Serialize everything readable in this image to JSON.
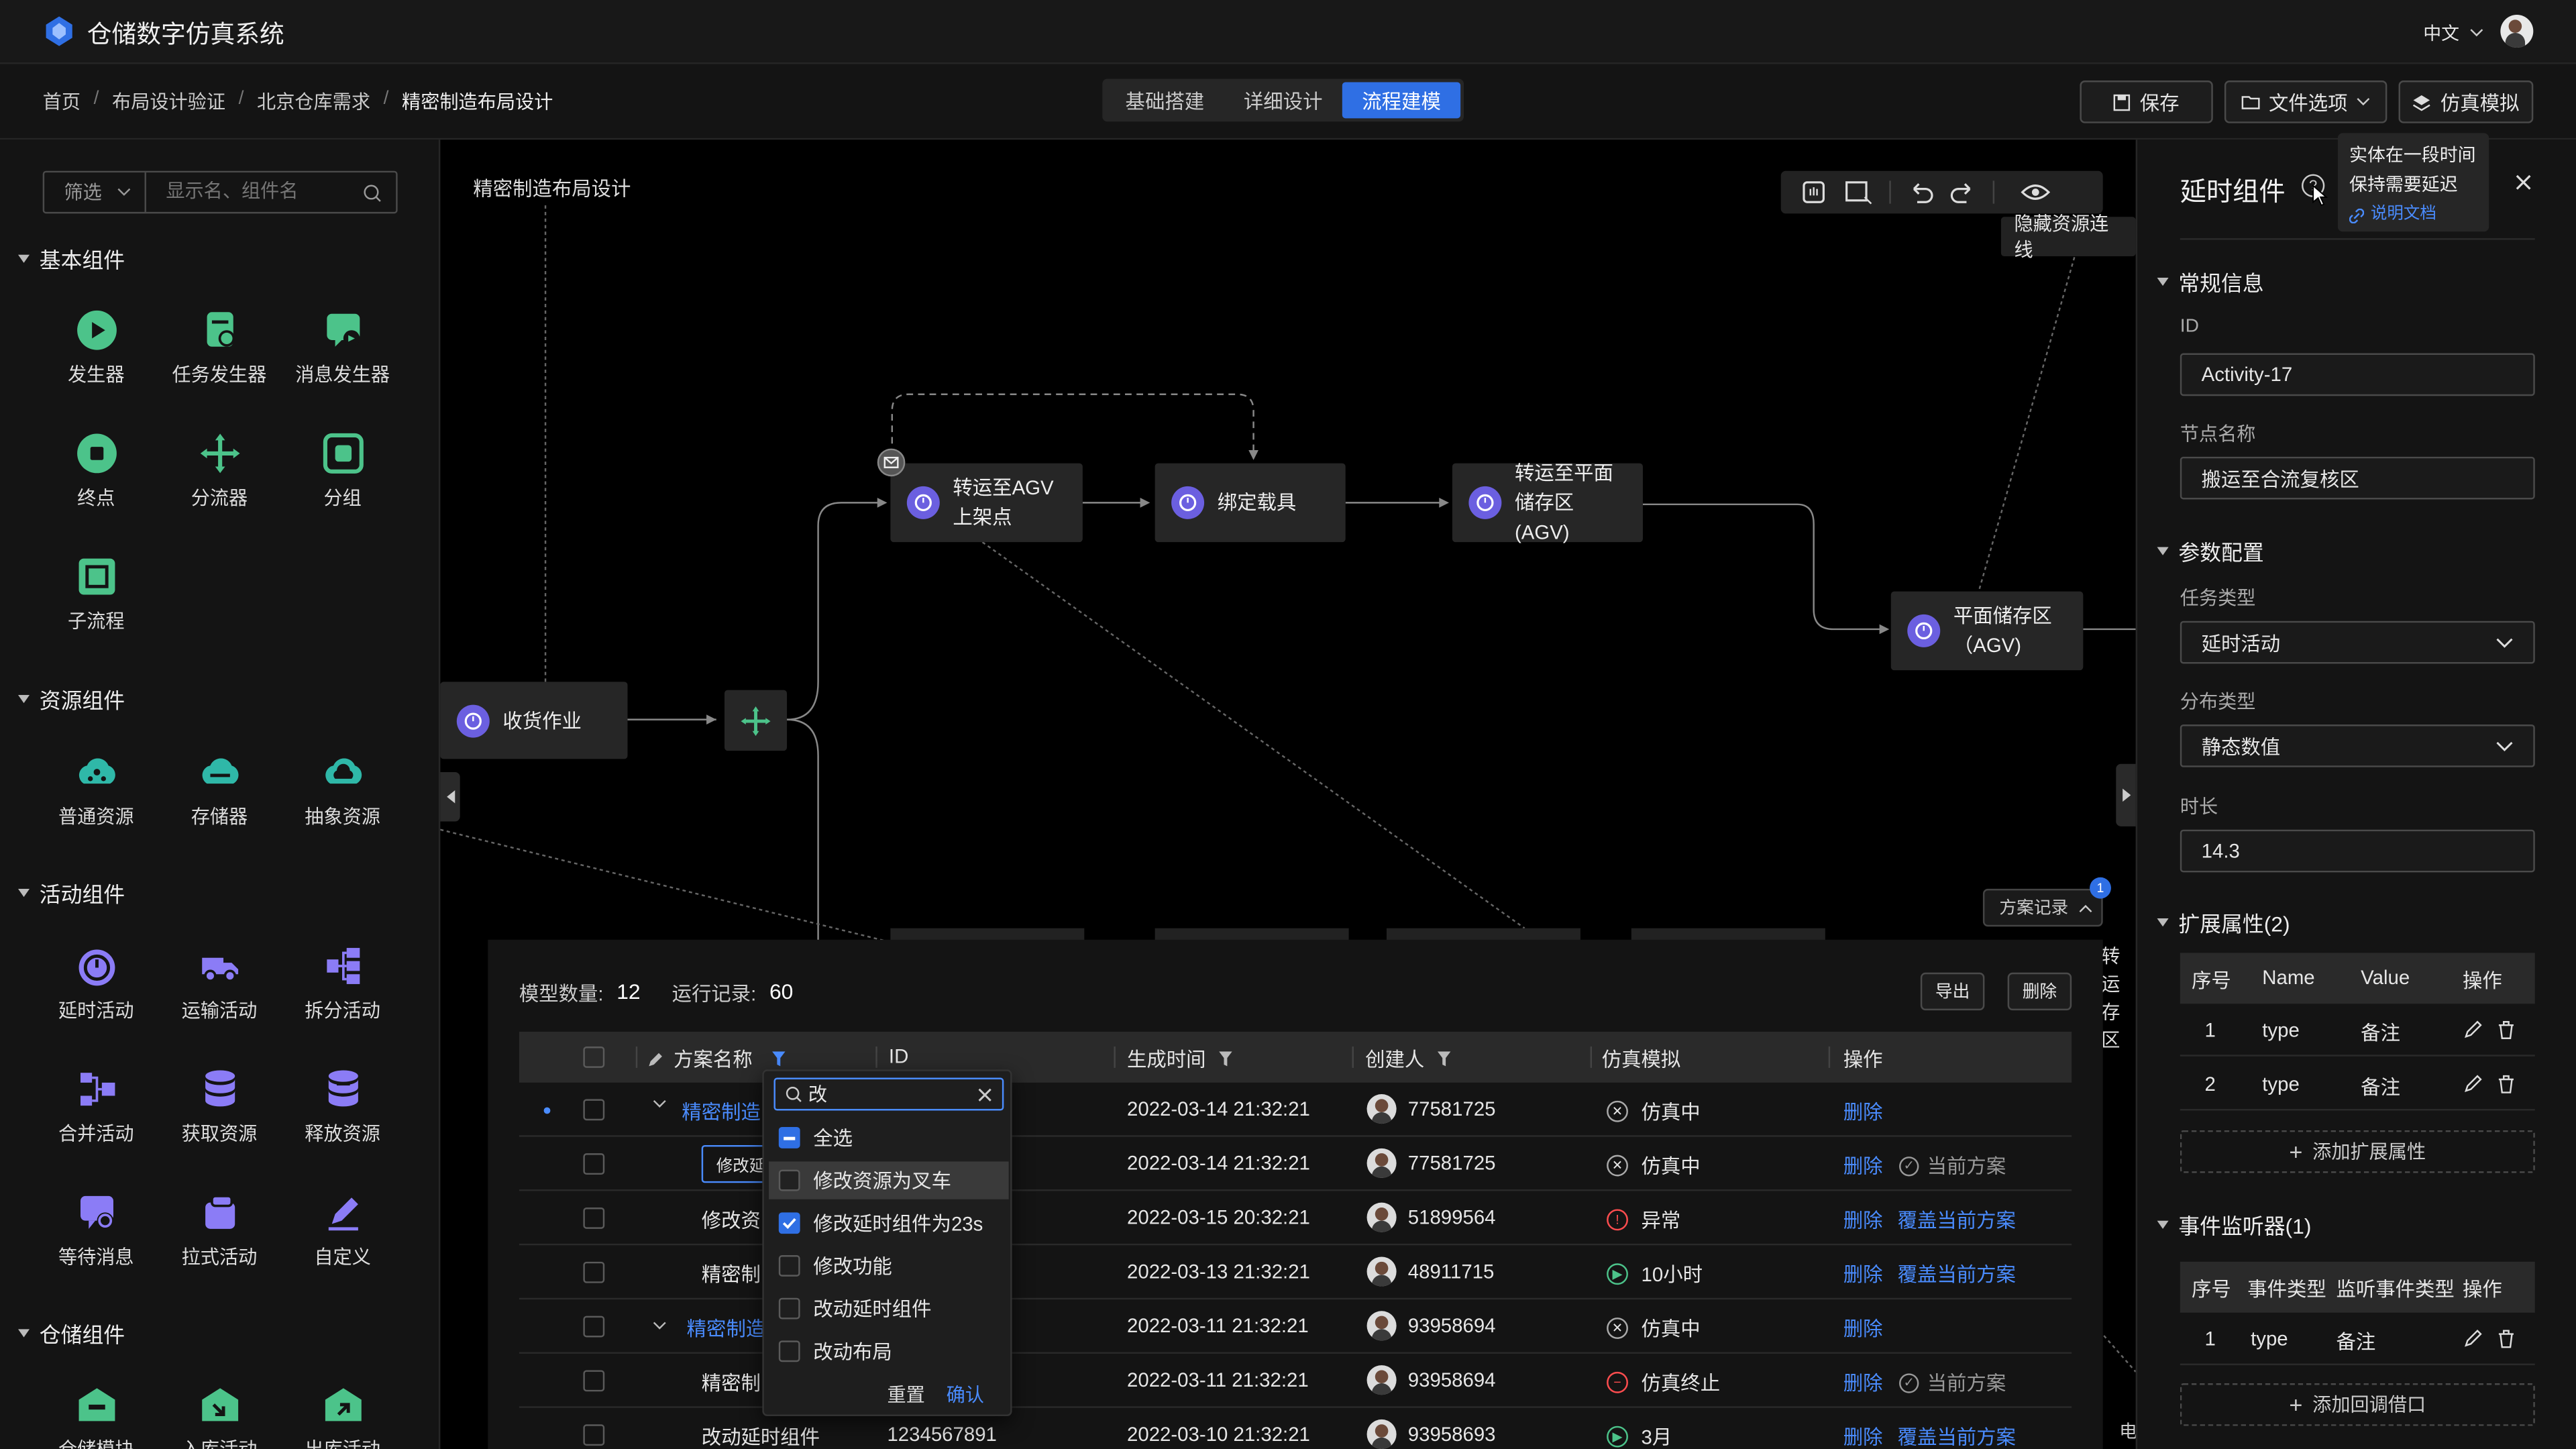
{
  "app": {
    "title": "仓储数字仿真系统",
    "lang": "中文"
  },
  "breadcrumb": [
    "首页",
    "布局设计验证",
    "北京仓库需求",
    "精密制造布局设计"
  ],
  "mode_tabs": [
    {
      "label": "基础搭建",
      "active": false
    },
    {
      "label": "详细设计",
      "active": false
    },
    {
      "label": "流程建模",
      "active": true
    }
  ],
  "toolbar": {
    "save": "保存",
    "file_options": "文件选项",
    "simulate": "仿真模拟"
  },
  "left": {
    "filter_label": "筛选",
    "search_placeholder": "显示名、组件名",
    "sections": [
      {
        "title": "基本组件",
        "items": [
          "发生器",
          "任务发生器",
          "消息发生器",
          "终点",
          "分流器",
          "分组",
          "子流程"
        ]
      },
      {
        "title": "资源组件",
        "items": [
          "普通资源",
          "存储器",
          "抽象资源"
        ]
      },
      {
        "title": "活动组件",
        "items": [
          "延时活动",
          "运输活动",
          "拆分活动",
          "合并活动",
          "获取资源",
          "释放资源",
          "等待消息",
          "拉式活动",
          "自定义"
        ]
      },
      {
        "title": "仓储组件",
        "items": [
          "仓储模块",
          "入库活动",
          "出库活动"
        ]
      }
    ]
  },
  "canvas": {
    "title": "精密制造布局设计",
    "hide_links_tooltip": "隐藏资源连线",
    "plan_record": "方案记录",
    "plan_badge": "1",
    "nodes": {
      "receive": "收货作业",
      "agv_up": "转运至AGV上架点",
      "bind": "绑定载具",
      "flat_agv": "转运至平面储存区(AGV)",
      "flat_store": "平面储存区（AGV)",
      "edge_a": "转运",
      "edge_b": "存区",
      "edge_c": "电"
    }
  },
  "bottom": {
    "model_count_label": "模型数量:",
    "model_count": "12",
    "run_count_label": "运行记录:",
    "run_count": "60",
    "export": "导出",
    "delete": "删除",
    "headers": [
      "方案名称",
      "ID",
      "生成时间",
      "创建人",
      "仿真模拟",
      "操作"
    ],
    "rows": [
      {
        "name": "精密制造",
        "id": "",
        "time": "2022-03-14 21:32:21",
        "creator": "77581725",
        "status": "仿真中",
        "status_kind": "x",
        "ops": [
          "删除"
        ],
        "expand": true,
        "dot": true,
        "link": true
      },
      {
        "name": "修改延",
        "id": "",
        "time": "2022-03-14 21:32:21",
        "creator": "77581725",
        "status": "仿真中",
        "status_kind": "x",
        "ops": [
          "删除"
        ],
        "current": "当前方案",
        "boxed": true
      },
      {
        "name": "修改资",
        "id": "",
        "time": "2022-03-15 20:32:21",
        "creator": "51899564",
        "status": "异常",
        "status_kind": "err",
        "ops": [
          "删除",
          "覆盖当前方案"
        ]
      },
      {
        "name": "精密制",
        "id": "",
        "time": "2022-03-13 21:32:21",
        "creator": "48911715",
        "status": "10小时",
        "status_kind": "play",
        "ops": [
          "删除",
          "覆盖当前方案"
        ]
      },
      {
        "name": "精密制造",
        "id": "",
        "time": "2022-03-11 21:32:21",
        "creator": "93958694",
        "status": "仿真中",
        "status_kind": "x",
        "ops": [
          "删除"
        ],
        "expand": true,
        "link": true
      },
      {
        "name": "精密制",
        "id": "",
        "time": "2022-03-11 21:32:21",
        "creator": "93958694",
        "status": "仿真终止",
        "status_kind": "stop",
        "ops": [
          "删除"
        ],
        "current": "当前方案"
      },
      {
        "name": "改动延时组件",
        "id": "1234567891",
        "time": "2022-03-10 21:32:21",
        "creator": "93958693",
        "status": "3月",
        "status_kind": "play",
        "ops": [
          "删除",
          "覆盖当前方案"
        ]
      }
    ]
  },
  "filter_popup": {
    "query": "改",
    "options": [
      {
        "label": "全选",
        "state": "partial"
      },
      {
        "label": "修改资源为叉车",
        "state": "off",
        "hover": true
      },
      {
        "label": "修改延时组件为23s",
        "state": "on"
      },
      {
        "label": "修改功能",
        "state": "off"
      },
      {
        "label": "改动延时组件",
        "state": "off"
      },
      {
        "label": "改动布局",
        "state": "off"
      }
    ],
    "reset": "重置",
    "confirm": "确认"
  },
  "right": {
    "title": "延时组件",
    "tooltip": {
      "line1": "实体在一段时间",
      "line2": "保持需要延迟",
      "doc": "说明文档"
    },
    "general": "常规信息",
    "id_label": "ID",
    "id_value": "Activity-17",
    "name_label": "节点名称",
    "name_value": "搬运至合流复核区",
    "params": "参数配置",
    "task_label": "任务类型",
    "task_value": "延时活动",
    "dist_label": "分布类型",
    "dist_value": "静态数值",
    "duration_label": "时长",
    "duration_value": "14.3",
    "ext_title": "扩展属性(2)",
    "ext_headers": [
      "序号",
      "Name",
      "Value",
      "操作"
    ],
    "ext_rows": [
      {
        "no": "1",
        "name": "type",
        "value": "备注"
      },
      {
        "no": "2",
        "name": "type",
        "value": "备注"
      }
    ],
    "add_ext": "添加扩展属性",
    "listener_title": "事件监听器(1)",
    "listener_headers": [
      "序号",
      "事件类型",
      "监听事件类型",
      "操作"
    ],
    "listener_rows": [
      {
        "no": "1",
        "type": "type",
        "listen": "备注"
      }
    ],
    "add_listener": "添加回调借口"
  },
  "colors": {
    "accent": "#2f6fe4",
    "link": "#4a8cff",
    "node_icon": "#6b5fe0",
    "component_green": "#4cc38a",
    "component_purple": "#8b7cf6",
    "component_teal": "#2fb8a8"
  }
}
